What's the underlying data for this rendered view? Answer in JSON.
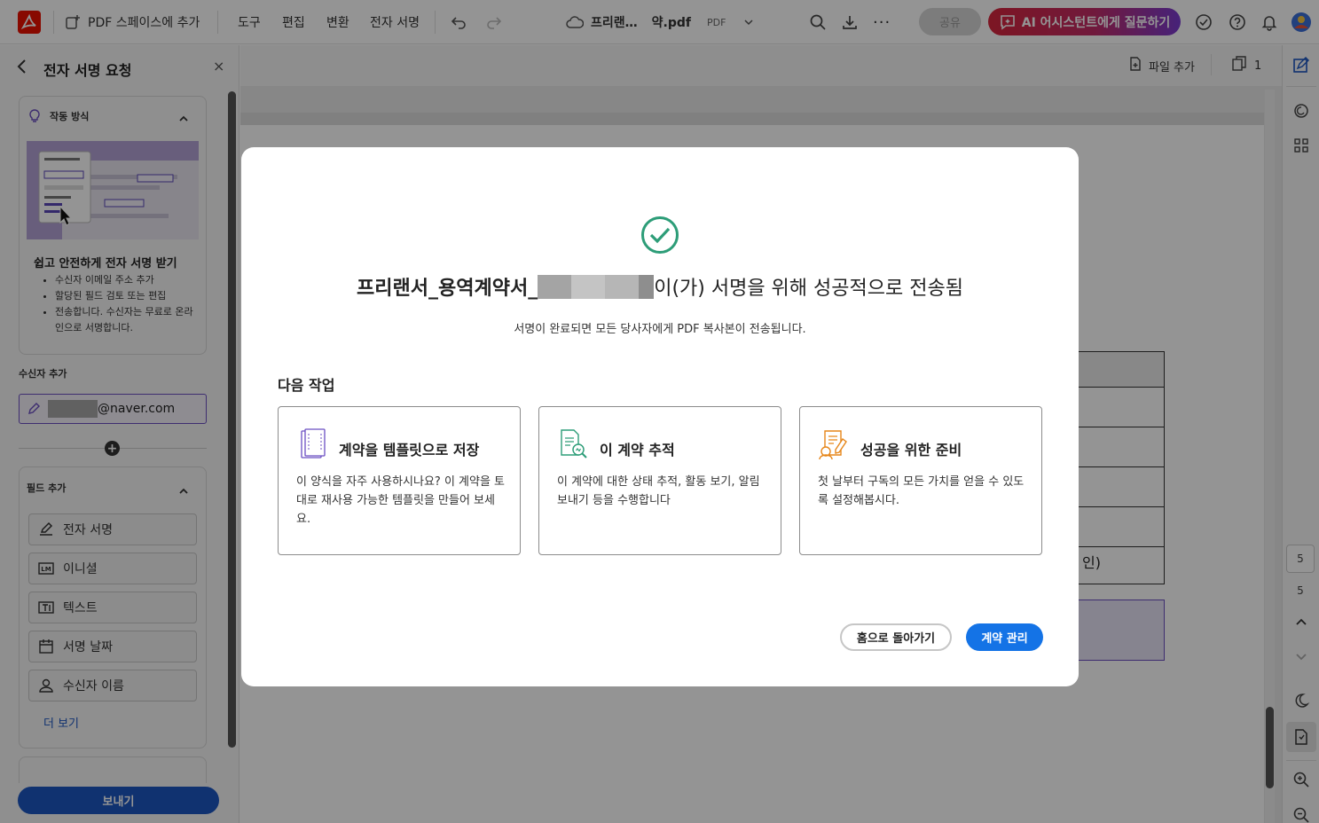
{
  "topbar": {
    "add_to_space": "PDF 스페이스에 추가",
    "menu": [
      "도구",
      "편집",
      "변환",
      "전자 서명"
    ],
    "file_name_prefix": "프리랜…",
    "file_name_suffix": "약.pdf",
    "file_type": "PDF",
    "share_label": "공유",
    "ai_label": "AI 어시스턴트에게 질문하기"
  },
  "left_panel": {
    "title": "전자 서명 요청",
    "how_it_works": {
      "label": "작동 방식",
      "heading": "쉽고 안전하게 전자 서명 받기",
      "bullets": [
        "수신자 이메일 주소 추가",
        "할당된 필드 검토 또는 편집",
        "전송합니다. 수신자는 무료로 온라인으로 서명합니다."
      ]
    },
    "recipients_label": "수신자 추가",
    "recipient_email": "@naver.com",
    "add_fields": {
      "label": "필드 추가",
      "items": [
        "전자 서명",
        "이니셜",
        "텍스트",
        "서명 날짜",
        "수신자 이름"
      ],
      "more_label": "더 보기"
    },
    "send_label": "보내기"
  },
  "doc_toolbar": {
    "add_file_label": "파일 추가",
    "page_count": "1"
  },
  "doc_fragment": {
    "cell_text": "인)"
  },
  "right_rail": {
    "page_label_1": "5",
    "page_label_2": "5"
  },
  "modal": {
    "title_prefix": "프리랜서_용역계약서_",
    "title_suffix": "이(가) 서명을 위해 성공적으로 전송됨",
    "subtitle": "서명이 완료되면 모든 당사자에게 PDF 복사본이 전송됩니다.",
    "next_steps_label": "다음 작업",
    "options": [
      {
        "title": "계약을 템플릿으로 저장",
        "desc": "이 양식을 자주 사용하시나요? 이 계약을 토대로 재사용 가능한 템플릿을 만들어 보세요."
      },
      {
        "title": "이 계약 추적",
        "desc": "이 계약에 대한 상태 추적, 활동 보기, 알림 보내기 등을 수행합니다"
      },
      {
        "title": "성공을 위한 준비",
        "desc": "첫 날부터 구독의 모든 가치를 얻을 수 있도록 설정해봅시다."
      }
    ],
    "home_button": "홈으로 돌아가기",
    "manage_button": "계약 관리"
  },
  "colors": {
    "accent": "#1473e6",
    "send_button": "#1d56c2",
    "success_green": "#2d9d78",
    "adobe_red": "#eb1000"
  },
  "icons": [
    "acrobat-logo-icon",
    "add-to-space-icon",
    "undo-icon",
    "redo-icon",
    "cloud-icon",
    "chevron-down-icon",
    "search-icon",
    "download-icon",
    "more-icon",
    "ai-chat-icon",
    "check-circle-icon",
    "help-icon",
    "bell-icon",
    "avatar"
  ]
}
